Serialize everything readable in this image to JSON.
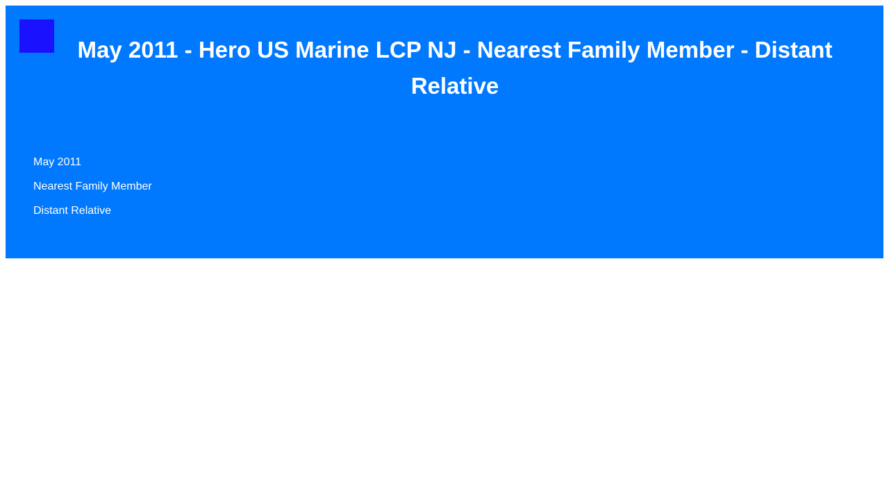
{
  "header": {
    "title": "May 2011 - Hero US Marine LCP NJ - Nearest Family Member - Distant Relative"
  },
  "list": {
    "items": [
      "May 2011",
      "Nearest Family Member",
      "Distant Relative"
    ]
  },
  "colors": {
    "banner": "#0079ff",
    "logo": "#1a12ff",
    "text": "#ffffff"
  }
}
